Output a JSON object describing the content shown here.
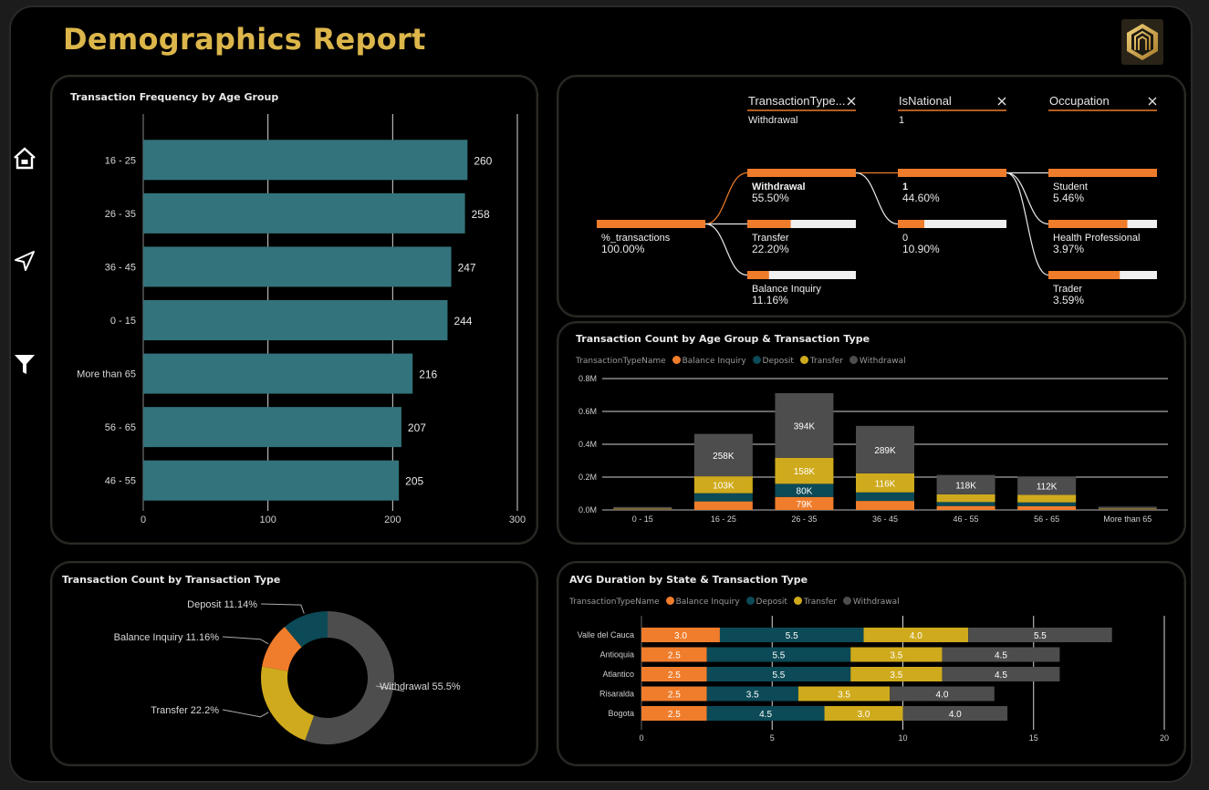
{
  "report_title": "Demographics Report",
  "logo_icon": "building-logo-icon",
  "nav": [
    {
      "name": "home-icon"
    },
    {
      "name": "navigate-icon"
    },
    {
      "name": "filter-icon"
    }
  ],
  "colors": {
    "title": "#dcb64a",
    "teal_bar": "#33737b",
    "balance_inquiry": "#f07d2c",
    "deposit": "#0c4a57",
    "transfer": "#cfaa1c",
    "withdrawal": "#4d4d4d",
    "decomp_bar": "#ee7c2b"
  },
  "chart_data": [
    {
      "id": "age_frequency",
      "type": "bar",
      "orientation": "horizontal",
      "title": "Transaction Frequency by Age Group",
      "categories": [
        "16 - 25",
        "26 - 35",
        "36 - 45",
        "0 - 15",
        "More than 65",
        "56 - 65",
        "46 - 55"
      ],
      "values": [
        260,
        258,
        247,
        244,
        216,
        207,
        205
      ],
      "xlim": [
        0,
        300
      ],
      "xticks": [
        "0",
        "100",
        "200",
        "300"
      ],
      "grid": true
    },
    {
      "id": "age_type_stacked",
      "type": "bar",
      "stacked": true,
      "title": "Transaction Count by Age Group & Transaction Type",
      "legend_title": "TransactionTypeName",
      "legend": [
        "Balance Inquiry",
        "Deposit",
        "Transfer",
        "Withdrawal"
      ],
      "categories": [
        "0 - 15",
        "16 - 25",
        "26 - 35",
        "36 - 45",
        "46 - 55",
        "56 - 65",
        "More than 65"
      ],
      "series": [
        {
          "name": "Balance Inquiry",
          "values": [
            0.003,
            0.052,
            0.079,
            0.055,
            0.024,
            0.023,
            0.003
          ]
        },
        {
          "name": "Deposit",
          "values": [
            0.002,
            0.05,
            0.08,
            0.052,
            0.024,
            0.023,
            0.002
          ]
        },
        {
          "name": "Transfer",
          "values": [
            0.003,
            0.103,
            0.158,
            0.116,
            0.047,
            0.046,
            0.003
          ]
        },
        {
          "name": "Withdrawal",
          "values": [
            0.01,
            0.258,
            0.394,
            0.289,
            0.118,
            0.112,
            0.012
          ]
        }
      ],
      "data_labels": [
        [],
        [
          {
            "series": 2,
            "text": "103K"
          },
          {
            "series": 3,
            "text": "258K"
          }
        ],
        [
          {
            "series": 0,
            "text": "79K"
          },
          {
            "series": 1,
            "text": "80K"
          },
          {
            "series": 2,
            "text": "158K"
          },
          {
            "series": 3,
            "text": "394K"
          }
        ],
        [
          {
            "series": 2,
            "text": "116K"
          },
          {
            "series": 3,
            "text": "289K"
          }
        ],
        [
          {
            "series": 3,
            "text": "118K"
          }
        ],
        [
          {
            "series": 3,
            "text": "112K"
          }
        ],
        []
      ],
      "ylim": [
        0,
        0.8
      ],
      "yticks": [
        "0.0M",
        "0.2M",
        "0.4M",
        "0.6M",
        "0.8M"
      ],
      "grid": true
    },
    {
      "id": "type_donut",
      "type": "pie",
      "donut": true,
      "title": "Transaction Count by Transaction Type",
      "categories": [
        "Withdrawal",
        "Transfer",
        "Balance Inquiry",
        "Deposit"
      ],
      "values": [
        55.5,
        22.2,
        11.16,
        11.14
      ],
      "labels": [
        "Withdrawal 55.5%",
        "Transfer 22.2%",
        "Balance Inquiry 11.16%",
        "Deposit 11.14%"
      ]
    },
    {
      "id": "state_duration",
      "type": "bar",
      "orientation": "horizontal",
      "stacked": true,
      "title": "AVG Duration by State & Transaction Type",
      "legend_title": "TransactionTypeName",
      "legend": [
        "Balance Inquiry",
        "Deposit",
        "Transfer",
        "Withdrawal"
      ],
      "categories": [
        "Valle del Cauca",
        "Antioquia",
        "Atlantico",
        "Risaralda",
        "Bogota"
      ],
      "series": [
        {
          "name": "Balance Inquiry",
          "values": [
            3.0,
            2.5,
            2.5,
            2.5,
            2.5
          ]
        },
        {
          "name": "Deposit",
          "values": [
            5.5,
            5.5,
            5.5,
            3.5,
            4.5
          ]
        },
        {
          "name": "Transfer",
          "values": [
            4.0,
            3.5,
            3.5,
            3.5,
            3.0
          ]
        },
        {
          "name": "Withdrawal",
          "values": [
            5.5,
            4.5,
            4.5,
            4.0,
            4.0
          ]
        }
      ],
      "xlim": [
        0,
        20
      ],
      "xticks": [
        "0",
        "5",
        "10",
        "15",
        "20"
      ],
      "grid": true
    }
  ],
  "decomposition": {
    "headers": [
      {
        "title": "TransactionType...",
        "value": "Withdrawal"
      },
      {
        "title": "IsNational",
        "value": "1"
      },
      {
        "title": "Occupation",
        "value": ""
      }
    ],
    "root": {
      "label": "%_transactions",
      "value": "100.00%",
      "fraction": 1.0
    },
    "level1": [
      {
        "label": "Withdrawal",
        "value": "55.50%",
        "fraction": 1.0,
        "selected": true
      },
      {
        "label": "Transfer",
        "value": "22.20%",
        "fraction": 0.4
      },
      {
        "label": "Balance Inquiry",
        "value": "11.16%",
        "fraction": 0.2
      }
    ],
    "level2": [
      {
        "label": "1",
        "value": "44.60%",
        "fraction": 1.0,
        "selected": true
      },
      {
        "label": "0",
        "value": "10.90%",
        "fraction": 0.244
      }
    ],
    "level3": [
      {
        "label": "Student",
        "value": "5.46%",
        "fraction": 1.0
      },
      {
        "label": "Health Professional",
        "value": "3.97%",
        "fraction": 0.727
      },
      {
        "label": "Trader",
        "value": "3.59%",
        "fraction": 0.657
      }
    ]
  }
}
